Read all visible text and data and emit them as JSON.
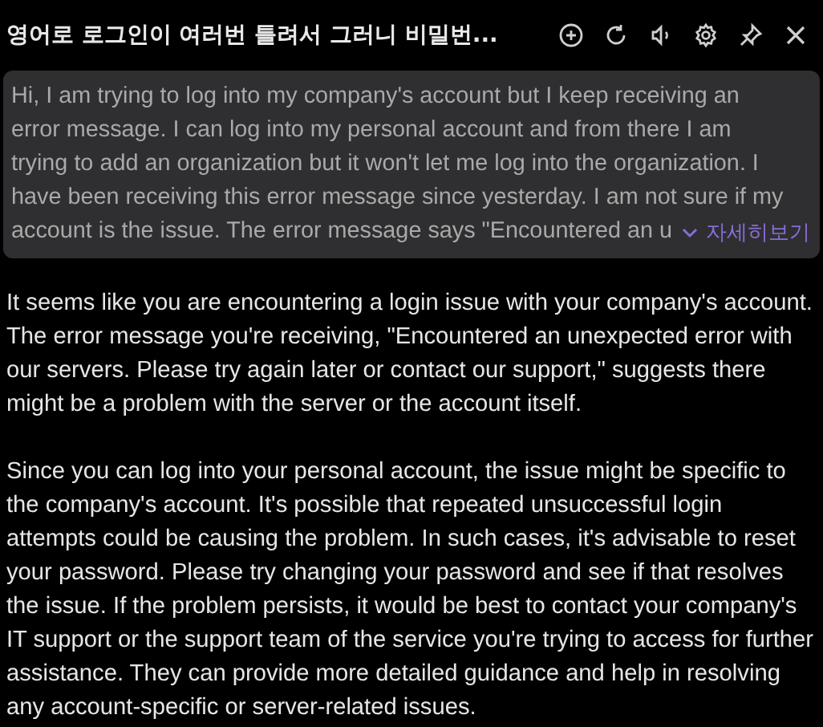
{
  "header": {
    "title": "영어로 로그인이 여러번 틀려서 그러니 비밀번..."
  },
  "toolbar": [
    {
      "kind": "add"
    },
    {
      "kind": "refresh"
    },
    {
      "kind": "sound"
    },
    {
      "kind": "settings"
    },
    {
      "kind": "pin"
    },
    {
      "kind": "close"
    }
  ],
  "question": {
    "lines": [
      "Hi, I am trying to log into my company's account but I keep receiving an",
      "error message. I can log into my personal account and from there I am",
      "trying to add an organization but it won't let me log into the organization. I",
      "have been receiving this error message since yesterday. I am not sure if my",
      "account is the issue. The error message says \"Encountered an u"
    ],
    "expanded": false,
    "more_label": "자세히보기"
  },
  "answer": [
    "It seems like you are encountering a login issue with your company's account. The error message you're receiving, \"Encountered an unexpected error with our servers. Please try again later or contact our support,\" suggests there might be a problem with the server or the account itself.",
    "Since you can log into your personal account, the issue might be specific to the company's account. It's possible that repeated unsuccessful login attempts could be causing the problem. In such cases, it's advisable to reset your password. Please try changing your password and see if that resolves the issue. If the problem persists, it would be best to contact your company's IT support or the support team of the service you're trying to access for further assistance. They can provide more detailed guidance and help in resolving any account-specific or server-related issues."
  ]
}
